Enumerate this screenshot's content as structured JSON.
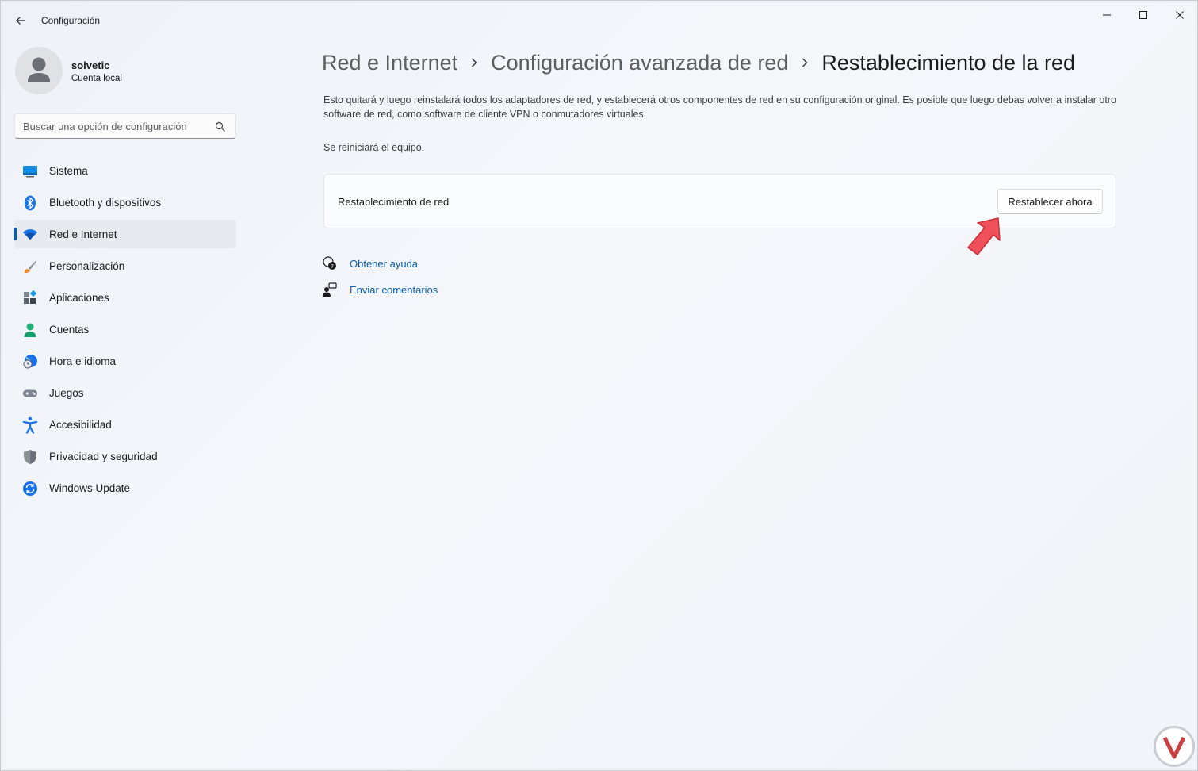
{
  "window": {
    "title": "Configuración",
    "controls": {
      "minimize": "minimize-icon",
      "maximize": "maximize-icon",
      "close": "close-icon"
    }
  },
  "profile": {
    "name": "solvetic",
    "account_type": "Cuenta local"
  },
  "search": {
    "placeholder": "Buscar una opción de configuración"
  },
  "sidebar": {
    "items": [
      {
        "label": "Sistema",
        "icon": "monitor-icon"
      },
      {
        "label": "Bluetooth y dispositivos",
        "icon": "bluetooth-icon"
      },
      {
        "label": "Red e Internet",
        "icon": "wifi-icon",
        "active": true
      },
      {
        "label": "Personalización",
        "icon": "brush-icon"
      },
      {
        "label": "Aplicaciones",
        "icon": "apps-icon"
      },
      {
        "label": "Cuentas",
        "icon": "person-icon"
      },
      {
        "label": "Hora e idioma",
        "icon": "globe-clock-icon"
      },
      {
        "label": "Juegos",
        "icon": "gamepad-icon"
      },
      {
        "label": "Accesibilidad",
        "icon": "accessibility-icon"
      },
      {
        "label": "Privacidad y seguridad",
        "icon": "shield-icon"
      },
      {
        "label": "Windows Update",
        "icon": "update-icon"
      }
    ]
  },
  "breadcrumb": {
    "items": [
      "Red e Internet",
      "Configuración avanzada de red",
      "Restablecimiento de la red"
    ]
  },
  "main": {
    "description": "Esto quitará y luego reinstalará todos los adaptadores de red, y establecerá otros componentes de red en su configuración original. Es posible que luego debas volver a instalar otro software de red, como software de cliente VPN o conmutadores virtuales.",
    "restart_note": "Se reiniciará el equipo.",
    "card": {
      "label": "Restablecimiento de red",
      "button": "Restablecer ahora"
    },
    "links": {
      "help": "Obtener ayuda",
      "feedback": "Enviar comentarios"
    }
  },
  "colors": {
    "accent": "#005fb8",
    "link": "#0a5ea8",
    "annotation_arrow": "#f0505a"
  }
}
